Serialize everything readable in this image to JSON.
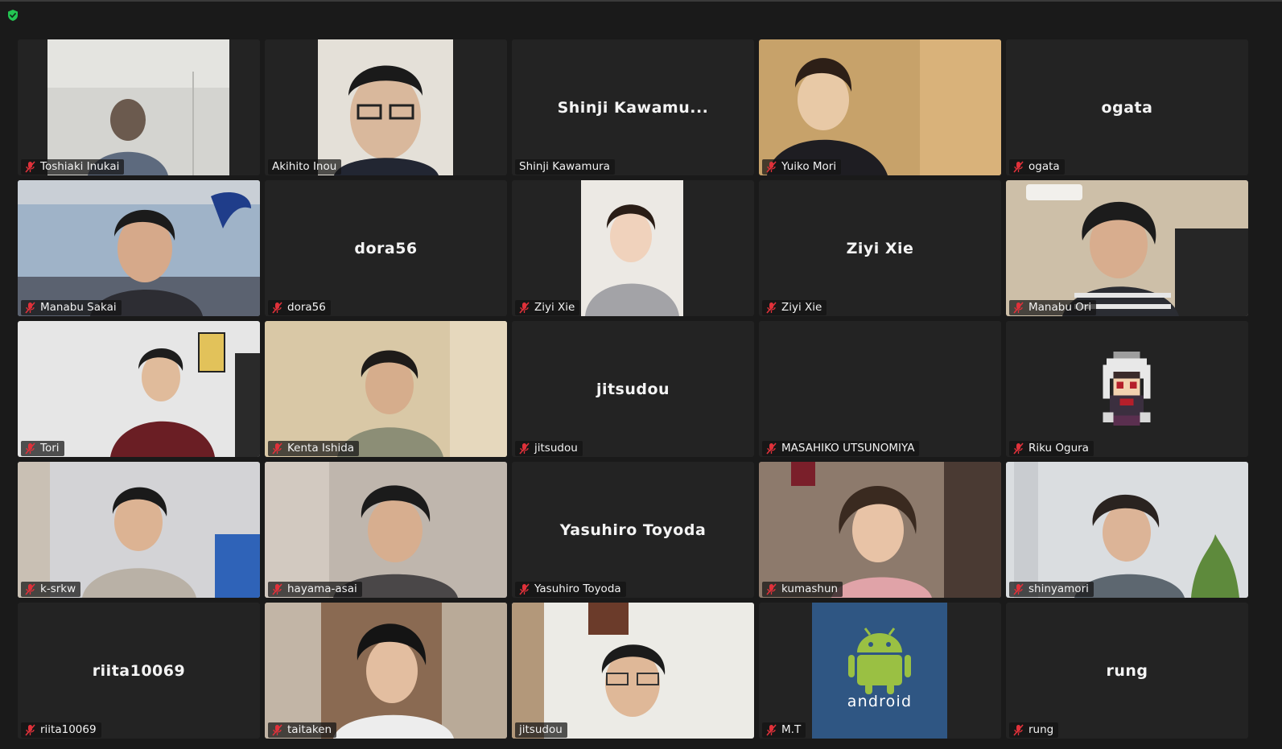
{
  "colors": {
    "background": "#1a1a1a",
    "tile": "#232323",
    "muted_mic": "#e0313a",
    "secure_shield": "#23c552"
  },
  "top": {
    "security_icon": "shield-check-icon"
  },
  "participants": [
    {
      "name": "Toshiaki Inukai",
      "muted": true,
      "video": true
    },
    {
      "name": "Akihito Inou",
      "muted": false,
      "video": true
    },
    {
      "name": "Shinji Kawamura",
      "display_name": "Shinji Kawamu...",
      "muted": false,
      "video": false
    },
    {
      "name": "Yuiko Mori",
      "muted": true,
      "video": true
    },
    {
      "name": "ogata",
      "display_name": "ogata",
      "muted": true,
      "video": false
    },
    {
      "name": "Manabu Sakai",
      "muted": true,
      "video": true
    },
    {
      "name": "dora56",
      "display_name": "dora56",
      "muted": true,
      "video": false
    },
    {
      "name": "Ziyi Xie",
      "muted": true,
      "video": true
    },
    {
      "name": "Ziyi Xie",
      "display_name": "Ziyi Xie",
      "muted": true,
      "video": false
    },
    {
      "name": "Manabu Ori",
      "muted": true,
      "video": true
    },
    {
      "name": "Tori",
      "muted": true,
      "video": true
    },
    {
      "name": "Kenta Ishida",
      "muted": true,
      "video": true
    },
    {
      "name": "jitsudou",
      "display_name": "jitsudou",
      "muted": true,
      "video": false
    },
    {
      "name": "MASAHIKO UTSUNOMIYA",
      "muted": true,
      "video": false
    },
    {
      "name": "Riku Ogura",
      "muted": true,
      "video": true
    },
    {
      "name": "k-srkw",
      "muted": true,
      "video": true
    },
    {
      "name": "hayama-asai",
      "muted": true,
      "video": true
    },
    {
      "name": "Yasuhiro Toyoda",
      "display_name": "Yasuhiro Toyoda",
      "muted": true,
      "video": false
    },
    {
      "name": "kumashun",
      "muted": true,
      "video": true
    },
    {
      "name": "shinyamori",
      "muted": true,
      "video": true
    },
    {
      "name": "riita10069",
      "display_name": "riita10069",
      "muted": true,
      "video": false
    },
    {
      "name": "taitaken",
      "muted": true,
      "video": true
    },
    {
      "name": "jitsudou",
      "muted": false,
      "video": true
    },
    {
      "name": "M.T",
      "muted": true,
      "video": true,
      "android_logo_text": "android"
    },
    {
      "name": "rung",
      "display_name": "rung",
      "muted": true,
      "video": false
    }
  ]
}
